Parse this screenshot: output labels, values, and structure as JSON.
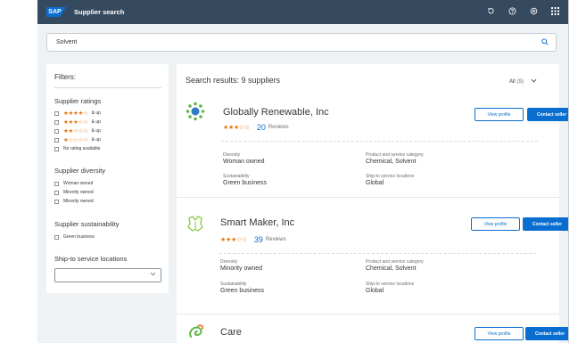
{
  "shell": {
    "logo": "SAP",
    "title": "Supplier search"
  },
  "search": {
    "value": "Solvent"
  },
  "filters": {
    "title": "Filters:",
    "ratings_title": "Supplier ratings",
    "ratings": [
      {
        "stars": "★★★★☆",
        "label": "& up"
      },
      {
        "stars": "★★★☆☆",
        "label": "& up"
      },
      {
        "stars": "★★☆☆☆",
        "label": "& up"
      },
      {
        "stars": "★☆☆☆☆",
        "label": "& up"
      }
    ],
    "no_rating": "No rating available",
    "diversity_title": "Supplier diversity",
    "diversity": [
      "Woman owned",
      "Minority owned",
      "Minority owned"
    ],
    "sustainability_title": "Supplier sustainability",
    "sustainability": [
      "Green business"
    ],
    "locations_title": "Ship-to service locations"
  },
  "results": {
    "title": "Search results: 9 suppliers",
    "all_label": "All",
    "all_count": "(9)",
    "labels": {
      "diversity": "Diversity",
      "category": "Product and service category",
      "sustainability": "Sustainability",
      "locations": "Ship-to service locations"
    },
    "buttons": {
      "view": "View profile",
      "contact": "Contact seller"
    },
    "suppliers": [
      {
        "name": "Globally Renewable, Inc",
        "stars": "★★★☆☆",
        "reviews": "20",
        "reviews_label": "Reviews",
        "diversity": "Woman owned",
        "category": "Chemical, Solvent",
        "sustainability": "Green business",
        "locations": "Global"
      },
      {
        "name": "Smart Maker, Inc",
        "stars": "★★★☆☆",
        "reviews": "39",
        "reviews_label": "Reviews",
        "diversity": "Minority owned",
        "category": "Chemical, Solvent",
        "sustainability": "Green business",
        "locations": "Global"
      },
      {
        "name": "Care"
      }
    ]
  },
  "colors": {
    "shell": "#354a5f",
    "accent": "#0a6ed1",
    "star": "#e9730c",
    "background": "#eff2f4"
  },
  "icons": [
    "sap-logo",
    "history-icon",
    "help-icon",
    "settings-icon",
    "app-launcher-icon",
    "search-icon",
    "chevron-down-icon",
    "sun-icon",
    "leaf-icon",
    "swirl-icon"
  ]
}
